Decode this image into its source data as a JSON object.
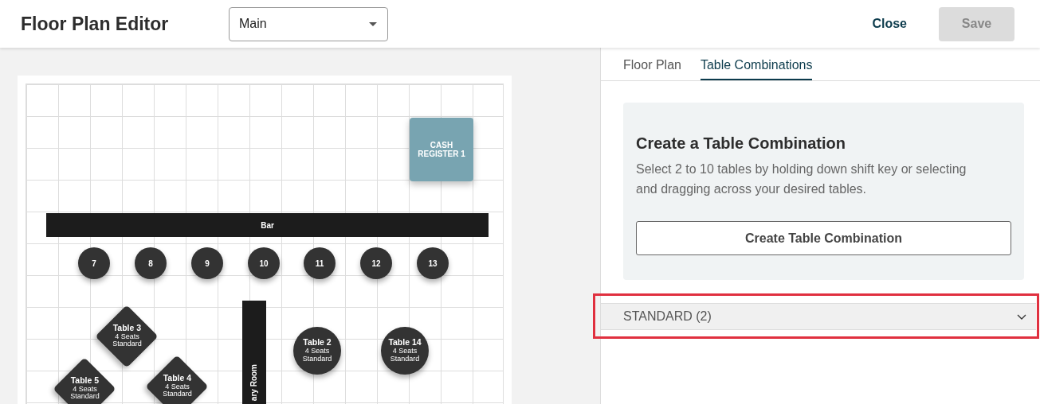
{
  "header": {
    "title": "Floor Plan Editor",
    "dropdown": {
      "value": "Main"
    },
    "close": "Close",
    "save": {
      "label": "Save",
      "disabled": true
    }
  },
  "floor_plan": {
    "items": [
      {
        "kind": "register",
        "label": "CASH REGISTER 1"
      },
      {
        "kind": "bar",
        "label": "Bar"
      },
      {
        "kind": "seat",
        "label": "7"
      },
      {
        "kind": "seat",
        "label": "8"
      },
      {
        "kind": "seat",
        "label": "9"
      },
      {
        "kind": "seat",
        "label": "10"
      },
      {
        "kind": "seat",
        "label": "11"
      },
      {
        "kind": "seat",
        "label": "12"
      },
      {
        "kind": "seat",
        "label": "13"
      },
      {
        "kind": "wall",
        "label": "ary Room"
      },
      {
        "kind": "diamond",
        "label": "Table 3",
        "seats": "4 Seats",
        "type": "Standard"
      },
      {
        "kind": "round",
        "label": "Table 2",
        "seats": "4 Seats",
        "type": "Standard"
      },
      {
        "kind": "round",
        "label": "Table 14",
        "seats": "4 Seats",
        "type": "Standard"
      },
      {
        "kind": "diamond",
        "label": "Table 5",
        "seats": "4 Seats",
        "type": "Standard"
      },
      {
        "kind": "diamond",
        "label": "Table 4",
        "seats": "4 Seats",
        "type": "Standard"
      }
    ]
  },
  "tabs": [
    {
      "label": "Floor Plan",
      "selected": false
    },
    {
      "label": "Table Combinations",
      "selected": true
    }
  ],
  "card": {
    "title": "Create a Table Combination",
    "text": "Select 2 to 10 tables by holding down shift key or selecting and dragging across your desired tables.",
    "button": "Create Table Combination"
  },
  "sections": [
    {
      "label": "STANDARD (2)",
      "expanded": false,
      "highlighted": true
    }
  ]
}
